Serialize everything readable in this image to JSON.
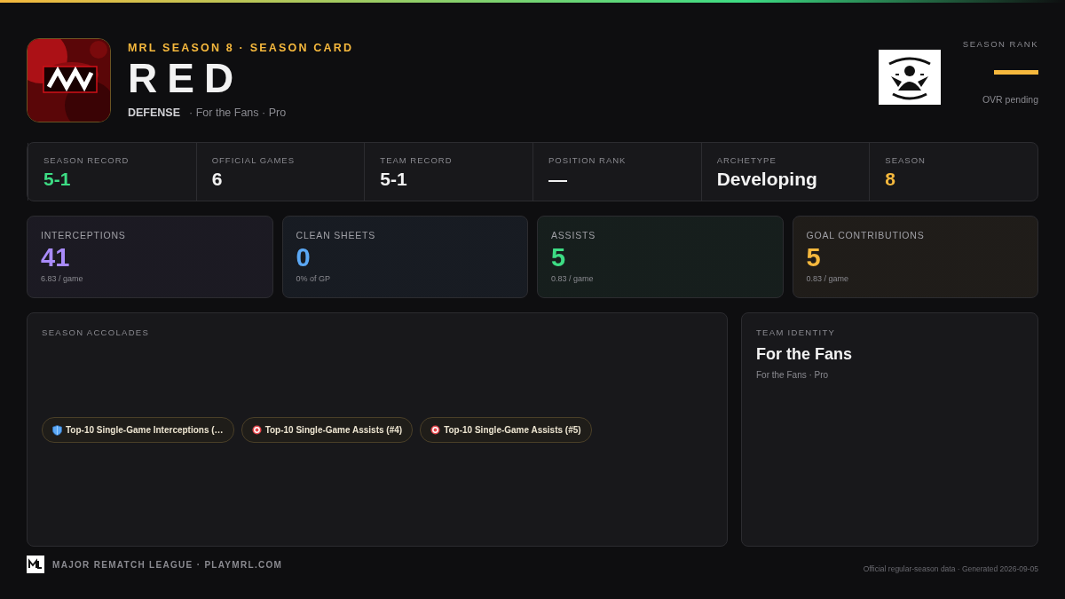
{
  "header": {
    "eyebrow": "MRL SEASON 8 · SEASON CARD",
    "name": "RED",
    "position": "DEFENSE",
    "team_line": "· For the Fans · Pro"
  },
  "rank": {
    "label": "SEASON RANK",
    "unranked": true,
    "note": "OVR pending"
  },
  "stats": [
    {
      "label": "SEASON RECORD",
      "value": "5-1",
      "color": "#3ddc84"
    },
    {
      "label": "OFFICIAL GAMES",
      "value": "6",
      "color": "#f2f2f2"
    },
    {
      "label": "TEAM RECORD",
      "value": "5-1",
      "color": "#f2f2f2"
    },
    {
      "label": "POSITION RANK",
      "value": "—",
      "color": "#f2f2f2"
    },
    {
      "label": "ARCHETYPE",
      "value": "Developing",
      "color": "#f2f2f2"
    },
    {
      "label": "SEASON",
      "value": "8",
      "color": "#f5b83d"
    }
  ],
  "cards": [
    {
      "label": "INTERCEPTIONS",
      "value": "41",
      "sub": "6.83 / game",
      "color": "#a98bfa"
    },
    {
      "label": "CLEAN SHEETS",
      "value": "0",
      "sub": "0% of GP",
      "color": "#5ba8f5"
    },
    {
      "label": "ASSISTS",
      "value": "5",
      "sub": "0.83 / game",
      "color": "#3ddc84"
    },
    {
      "label": "GOAL CONTRIBUTIONS",
      "value": "5",
      "sub": "0.83 / game",
      "color": "#f5b83d"
    }
  ],
  "accolades": {
    "title": "SEASON ACCOLADES",
    "items": [
      {
        "kind": "shield",
        "label": "Top-10 Single-Game Interceptions (…"
      },
      {
        "kind": "target",
        "label": "Top-10 Single-Game Assists (#4)"
      },
      {
        "kind": "target",
        "label": "Top-10 Single-Game Assists (#5)"
      }
    ]
  },
  "team_identity": {
    "title": "TEAM IDENTITY",
    "name": "For the Fans",
    "sub": "For the Fans · Pro"
  },
  "footer": {
    "league": "MAJOR REMATCH LEAGUE · PLAYMRL.COM",
    "note": "Official regular-season data · Generated 2026-09-05"
  }
}
